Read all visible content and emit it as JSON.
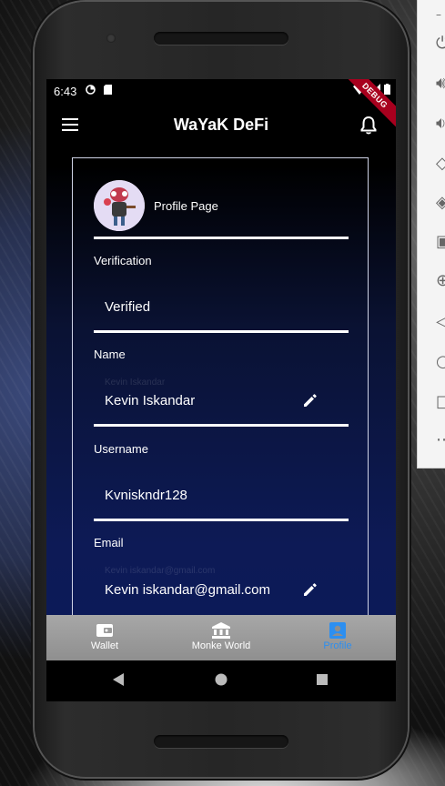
{
  "status_bar": {
    "time": "6:43",
    "debug": "DEBUG"
  },
  "app_bar": {
    "title": "WaYaK DeFi"
  },
  "profile": {
    "label": "Profile Page"
  },
  "fields": [
    {
      "label": "Verification",
      "value": "Verified",
      "hint": "",
      "editable": false
    },
    {
      "label": "Name",
      "value": "Kevin Iskandar",
      "hint": "Kevin Iskandar",
      "editable": true
    },
    {
      "label": "Username",
      "value": "Kvniskndr128",
      "hint": "",
      "editable": false
    },
    {
      "label": "Email",
      "value": "Kevin iskandar@gmail.com",
      "hint": "Kevin iskandar@gmail.com",
      "editable": true
    }
  ],
  "bottom_nav": [
    {
      "label": "Wallet",
      "icon": "wallet-icon",
      "active": false
    },
    {
      "label": "Monke World",
      "icon": "bank-icon",
      "active": false
    },
    {
      "label": "Profile",
      "icon": "profile-icon",
      "active": true
    }
  ],
  "colors": {
    "accent": "#2d8ff0",
    "screen_bg": "#0b1a5a",
    "debug": "#a8001e"
  }
}
